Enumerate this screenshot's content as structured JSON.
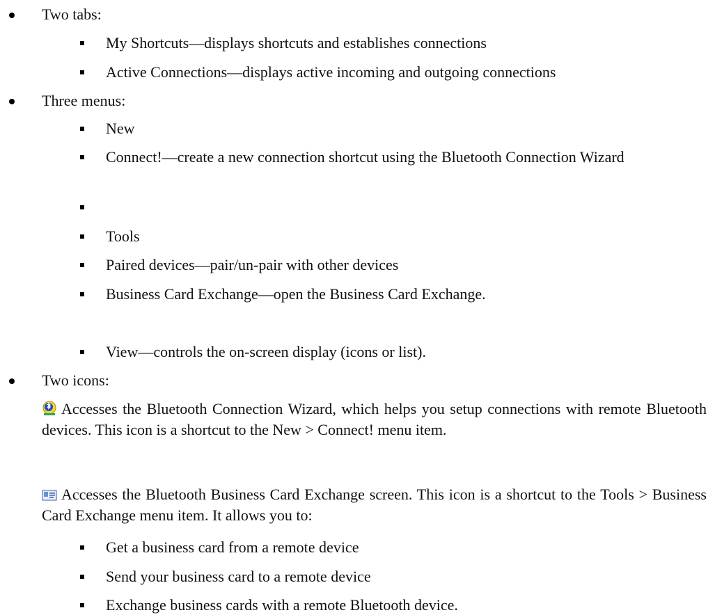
{
  "tabs": {
    "heading": "Two tabs:",
    "items": [
      "My Shortcuts—displays shortcuts and establishes connections",
      "Active Connections—displays active incoming and outgoing connections"
    ]
  },
  "menus": {
    "heading": "Three menus:",
    "new_label": "New",
    "new_items": [
      "Connect!—create a new connection shortcut using the Bluetooth Connection Wizard",
      ""
    ],
    "tools_label": "Tools",
    "tools_items": [
      "Paired devices—pair/un-pair with other devices",
      "Business Card Exchange—open the Business  Card Exchange."
    ],
    "view_item": "View—controls the on-screen display (icons or list)."
  },
  "icons": {
    "heading": "Two icons:",
    "wizard_icon": "bluetooth-wizard-icon",
    "wizard_text": "Accesses the Bluetooth Connection Wizard, which helps you setup connections with remote Bluetooth devices. This icon is a shortcut to the New > Connect!  menu item.",
    "card_icon": "business-card-icon",
    "card_text": "Accesses the Bluetooth Business Card Exchange screen.  This icon is a shortcut to the Tools > Business Card Exchange menu item. It allows you to:",
    "card_items": [
      "Get a business card from a remote device",
      "Send your business card to a remote device",
      "Exchange business cards with a remote Bluetooth device."
    ]
  }
}
